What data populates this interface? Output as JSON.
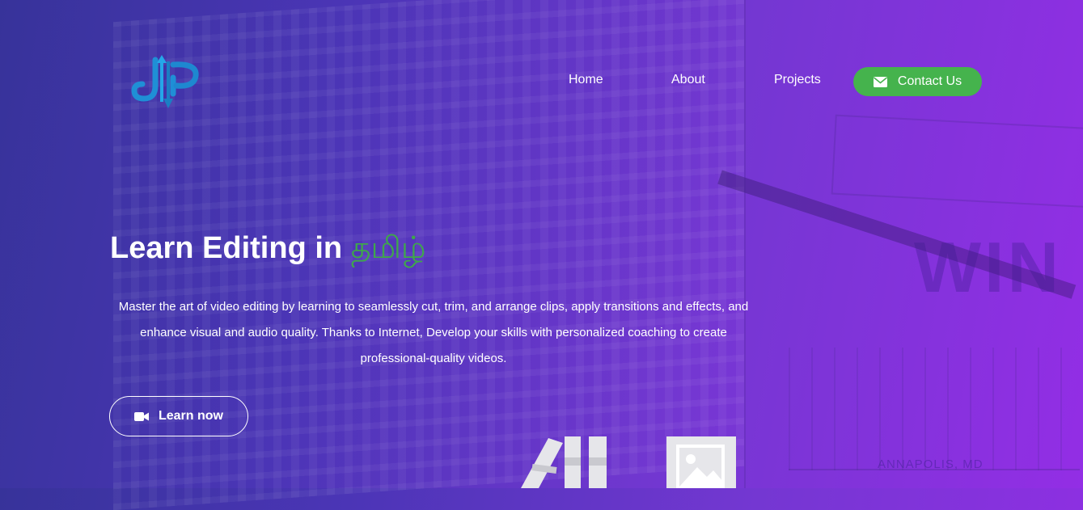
{
  "nav": {
    "logo_alt": "JP logo",
    "links": [
      "Home",
      "About",
      "Projects"
    ],
    "contact_label": "Contact Us",
    "contact_icon": "envelope-icon"
  },
  "hero": {
    "title_main": "Learn Editing in ",
    "title_accent": "தமிழ்",
    "description": "Master the art of video editing by learning to seamlessly cut, trim, and arrange clips, apply transitions and effects, and enhance visual and audio quality. Thanks to Internet, Develop your skills with personalized coaching to create professional-quality videos.",
    "cta_label": "Learn now",
    "cta_icon": "video-camera-icon"
  },
  "background": {
    "sign_text": "WIN",
    "caption": "ANNAPOLIS, MD"
  },
  "colors": {
    "accent_green": "#45b34d",
    "title_accent": "#3fa64c",
    "gradient_start": "#37339a",
    "gradient_end": "#932ee5",
    "logo_blue": "#1f8fd6"
  }
}
